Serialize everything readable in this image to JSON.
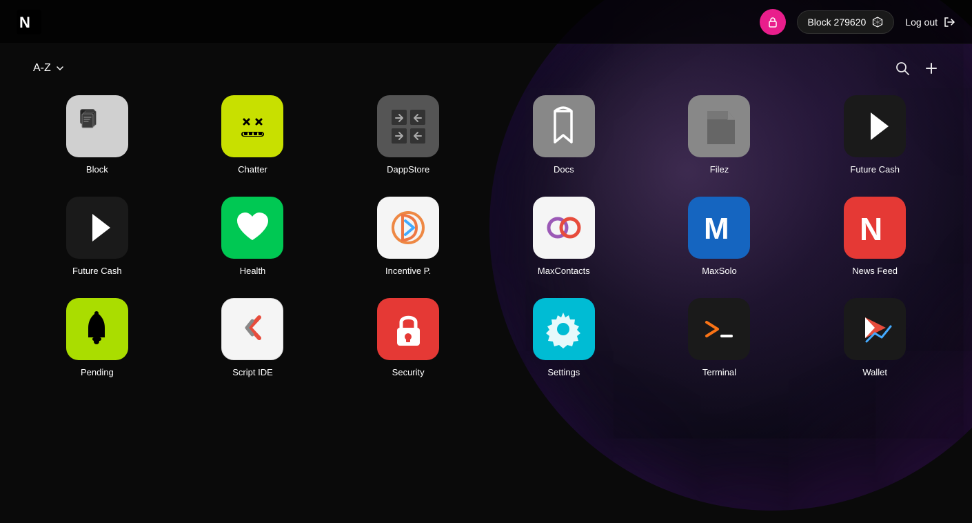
{
  "navbar": {
    "logo_alt": "App Logo",
    "lock_icon": "🔒",
    "block_label": "Block 279620",
    "cube_icon": "⬡",
    "logout_label": "Log out",
    "logout_icon": "→"
  },
  "toolbar": {
    "sort_label": "A-Z",
    "sort_icon": "chevron-down",
    "search_icon": "🔍",
    "add_icon": "+"
  },
  "apps": [
    {
      "id": "block",
      "label": "Block",
      "icon_class": "icon-block"
    },
    {
      "id": "chatter",
      "label": "Chatter",
      "icon_class": "icon-chatter"
    },
    {
      "id": "dappstore",
      "label": "DappStore",
      "icon_class": "icon-dappstore"
    },
    {
      "id": "docs",
      "label": "Docs",
      "icon_class": "icon-docs"
    },
    {
      "id": "filez",
      "label": "Filez",
      "icon_class": "icon-filez"
    },
    {
      "id": "futurecash1",
      "label": "Future Cash",
      "icon_class": "icon-futurecash1"
    },
    {
      "id": "futurecash2",
      "label": "Future Cash",
      "icon_class": "icon-futurecash2"
    },
    {
      "id": "health",
      "label": "Health",
      "icon_class": "icon-health"
    },
    {
      "id": "incentive",
      "label": "Incentive P.",
      "icon_class": "icon-incentive"
    },
    {
      "id": "maxcontacts",
      "label": "MaxContacts",
      "icon_class": "icon-maxcontacts"
    },
    {
      "id": "maxsolo",
      "label": "MaxSolo",
      "icon_class": "icon-maxsolo"
    },
    {
      "id": "newsfeed",
      "label": "News Feed",
      "icon_class": "icon-newsfeed"
    },
    {
      "id": "pending",
      "label": "Pending",
      "icon_class": "icon-pending"
    },
    {
      "id": "scriptide",
      "label": "Script IDE",
      "icon_class": "icon-scriptide"
    },
    {
      "id": "security",
      "label": "Security",
      "icon_class": "icon-security"
    },
    {
      "id": "settings",
      "label": "Settings",
      "icon_class": "icon-settings"
    },
    {
      "id": "terminal",
      "label": "Terminal",
      "icon_class": "icon-terminal"
    },
    {
      "id": "wallet",
      "label": "Wallet",
      "icon_class": "icon-wallet"
    }
  ]
}
